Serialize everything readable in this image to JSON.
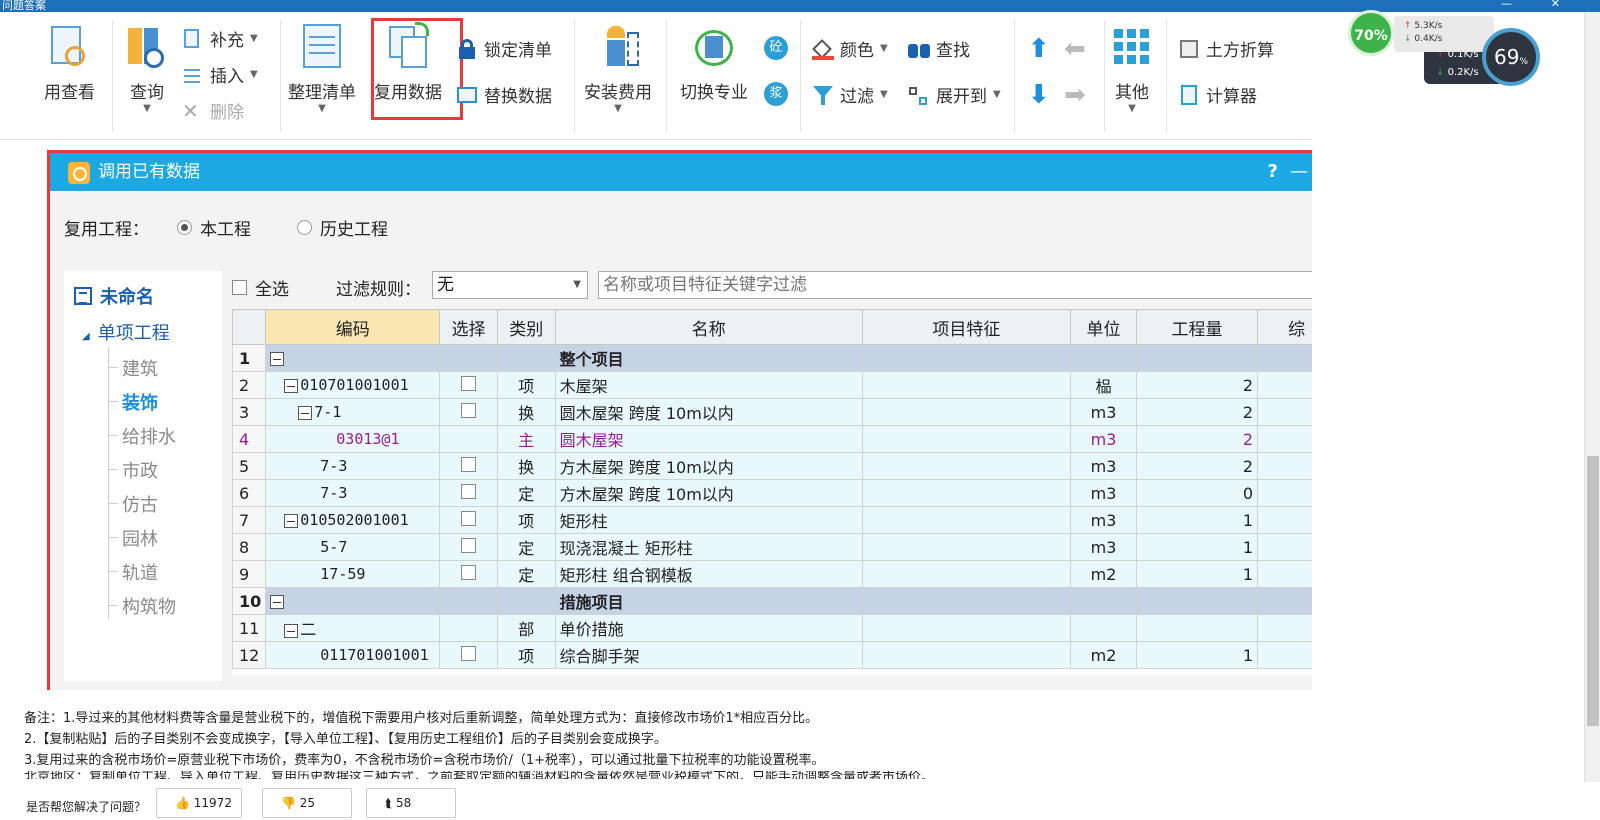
{
  "window": {
    "title": "问题答案",
    "close": "✕",
    "min": "—"
  },
  "ribbon": {
    "view_usage": "用查看",
    "query": "查询",
    "supplement": "补充",
    "insert": "插入",
    "delete": "删除",
    "organize": "整理清单",
    "reuse_data": "复用数据",
    "lock_list": "锁定清单",
    "replace_data": "替换数据",
    "install_fee": "安装费用",
    "switch_major": "切换专业",
    "concrete_badge": "砼",
    "slurry_badge": "浆",
    "color": "颜色",
    "find": "查找",
    "filter": "过滤",
    "expand_to": "展开到",
    "other": "其他",
    "earthwork": "土方折算",
    "calculator": "计算器"
  },
  "net": {
    "cpu": "70%",
    "up": "5.3K/s",
    "down": "0.4K/s",
    "up2": "0.1K/s",
    "down2": "0.2K/s",
    "mem": "69"
  },
  "dialog": {
    "title": "调用已有数据",
    "help": "?",
    "min": "—",
    "reuse_label": "复用工程：",
    "opt_current": "本工程",
    "opt_history": "历史工程",
    "select_all": "全选",
    "filter_rule_label": "过滤规则：",
    "filter_rule_value": "无",
    "filter_placeholder": "名称或项目特征关键字过滤",
    "tree": {
      "root": "未命名",
      "branch": "单项工程",
      "leaves": [
        "建筑",
        "装饰",
        "给排水",
        "市政",
        "仿古",
        "园林",
        "轨道",
        "构筑物"
      ]
    },
    "columns": [
      "编码",
      "选择",
      "类别",
      "名称",
      "项目特征",
      "单位",
      "工程量",
      "综"
    ],
    "rows": [
      {
        "n": "1",
        "code": "",
        "type": "",
        "name": "整个项目",
        "unit": "",
        "qty": ""
      },
      {
        "n": "2",
        "code": "010701001001",
        "type": "项",
        "name": "木屋架",
        "unit": "榀",
        "qty": "2"
      },
      {
        "n": "3",
        "code": "7-1",
        "type": "换",
        "name": "圆木屋架 跨度 10m以内",
        "unit": "m3",
        "qty": "2"
      },
      {
        "n": "4",
        "code": "03013@1",
        "type": "主",
        "name": "圆木屋架",
        "unit": "m3",
        "qty": "2"
      },
      {
        "n": "5",
        "code": "7-3",
        "type": "换",
        "name": "方木屋架 跨度 10m以内",
        "unit": "m3",
        "qty": "2"
      },
      {
        "n": "6",
        "code": "7-3",
        "type": "定",
        "name": "方木屋架 跨度 10m以内",
        "unit": "m3",
        "qty": "0"
      },
      {
        "n": "7",
        "code": "010502001001",
        "type": "项",
        "name": "矩形柱",
        "unit": "m3",
        "qty": "1"
      },
      {
        "n": "8",
        "code": "5-7",
        "type": "定",
        "name": "现浇混凝土 矩形柱",
        "unit": "m3",
        "qty": "1"
      },
      {
        "n": "9",
        "code": "17-59",
        "type": "定",
        "name": "矩形柱 组合钢模板",
        "unit": "m2",
        "qty": "1"
      },
      {
        "n": "10",
        "code": "",
        "type": "",
        "name": "措施项目",
        "unit": "",
        "qty": ""
      },
      {
        "n": "11",
        "code": "二",
        "type": "部",
        "name": "单价措施",
        "unit": "",
        "qty": ""
      },
      {
        "n": "12",
        "code": "011701001001",
        "type": "项",
        "name": "综合脚手架",
        "unit": "m2",
        "qty": "1"
      }
    ]
  },
  "notes": [
    "备注：1.导过来的其他材料费等含量是营业税下的，增值税下需要用户核对后重新调整，简单处理方式为：直接修改市场价1*相应百分比。",
    "2.【复制粘贴】后的子目类别不会变成换字，【导入单位工程】、【复用历史工程组价】后的子目类别会变成换字。",
    "3.复用过来的含税市场价=原营业税下市场价，费率为0，不含税市场价=含税市场价/（1+税率），可以通过批量下拉税率的功能设置税率。",
    "北京地区：复制单位工程、导入单位工程、复用历史数据这三种方式，之前套取定额的辅消材料的含量依然是营业税模式下的，只能手动调整含量或者市场价。"
  ],
  "feedback": {
    "question": "是否帮您解决了问题？",
    "likes": "11972",
    "dislikes": "25",
    "shares": "58"
  },
  "colors": {
    "accent": "#1ba8e3",
    "highlight": "#e83a3a",
    "group_row": "#c6d3e4",
    "main_item": "#9b1b9b"
  }
}
